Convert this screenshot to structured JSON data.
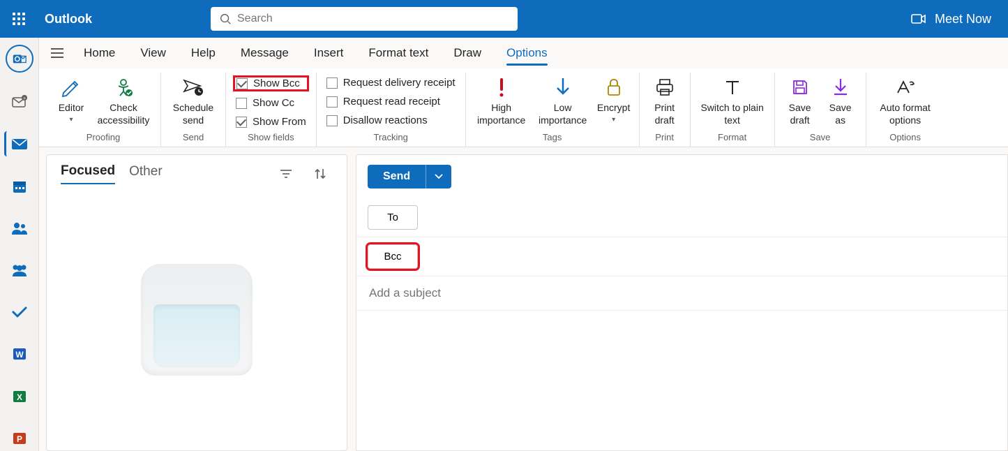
{
  "app": {
    "name": "Outlook"
  },
  "search": {
    "placeholder": "Search"
  },
  "meet_now": {
    "label": "Meet Now"
  },
  "tabs": {
    "home": "Home",
    "view": "View",
    "help": "Help",
    "message": "Message",
    "insert": "Insert",
    "format_text": "Format text",
    "draw": "Draw",
    "options": "Options"
  },
  "ribbon": {
    "proofing": {
      "label": "Proofing",
      "editor": "Editor",
      "check_accessibility": "Check accessibility"
    },
    "send": {
      "label": "Send",
      "schedule_send": "Schedule send"
    },
    "show_fields": {
      "label": "Show fields",
      "show_bcc": "Show Bcc",
      "show_cc": "Show Cc",
      "show_from": "Show From"
    },
    "tracking": {
      "label": "Tracking",
      "request_delivery_receipt": "Request delivery receipt",
      "request_read_receipt": "Request read receipt",
      "disallow_reactions": "Disallow reactions"
    },
    "tags": {
      "label": "Tags",
      "high_importance": "High importance",
      "low_importance": "Low importance",
      "encrypt": "Encrypt"
    },
    "print": {
      "label": "Print",
      "print_draft": "Print draft"
    },
    "format": {
      "label": "Format",
      "switch_plain": "Switch to plain text"
    },
    "save": {
      "label": "Save",
      "save_draft": "Save draft",
      "save_as": "Save as"
    },
    "options": {
      "label": "Options",
      "auto_format": "Auto format options"
    }
  },
  "list": {
    "focused": "Focused",
    "other": "Other"
  },
  "compose": {
    "send": "Send",
    "to": "To",
    "bcc": "Bcc",
    "subject_placeholder": "Add a subject"
  }
}
